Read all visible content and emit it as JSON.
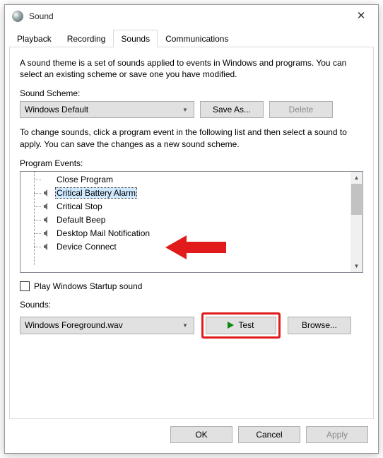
{
  "window": {
    "title": "Sound"
  },
  "tabs": [
    "Playback",
    "Recording",
    "Sounds",
    "Communications"
  ],
  "active_tab_index": 2,
  "panel": {
    "description": "A sound theme is a set of sounds applied to events in Windows and programs.  You can select an existing scheme or save one you have modified.",
    "scheme_label": "Sound Scheme:",
    "scheme_value": "Windows Default",
    "save_as_label": "Save As...",
    "delete_label": "Delete",
    "change_desc": "To change sounds, click a program event in the following list and then select a sound to apply.  You can save the changes as a new sound scheme.",
    "events_label": "Program Events:",
    "events": [
      {
        "label": "Close Program",
        "has_sound": false,
        "selected": false
      },
      {
        "label": "Critical Battery Alarm",
        "has_sound": true,
        "selected": true
      },
      {
        "label": "Critical Stop",
        "has_sound": true,
        "selected": false
      },
      {
        "label": "Default Beep",
        "has_sound": true,
        "selected": false
      },
      {
        "label": "Desktop Mail Notification",
        "has_sound": true,
        "selected": false
      },
      {
        "label": "Device Connect",
        "has_sound": true,
        "selected": false
      }
    ],
    "startup_checkbox_label": "Play Windows Startup sound",
    "startup_checked": false,
    "sounds_label": "Sounds:",
    "sounds_value": "Windows Foreground.wav",
    "test_label": "Test",
    "browse_label": "Browse..."
  },
  "buttons": {
    "ok": "OK",
    "cancel": "Cancel",
    "apply": "Apply"
  },
  "annotations": {
    "arrow_target": "Critical Battery Alarm",
    "test_highlighted": true
  }
}
